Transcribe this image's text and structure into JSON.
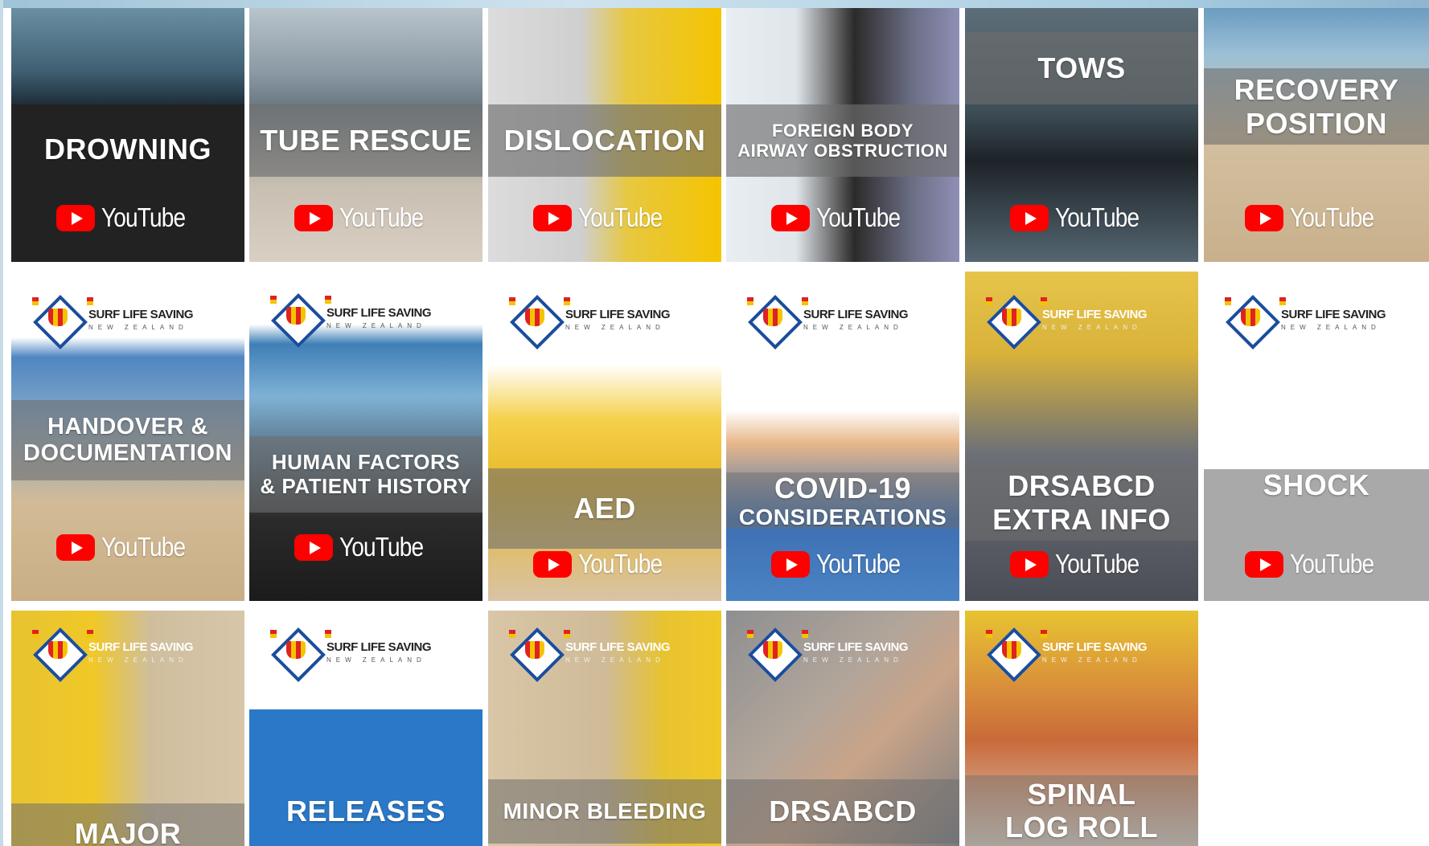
{
  "colors": {
    "youtube_red": "#ff0000",
    "band_grey": "#8c8c8c",
    "surf_yellow": "#f5c400",
    "surf_red": "#e02222",
    "logo_blue": "#1b4d9c"
  },
  "youtube": {
    "label": "YouTube",
    "icon": "youtube-play-icon"
  },
  "logo": {
    "main": "SURF LIFE SAVING",
    "sub": "NEW ZEALAND"
  },
  "tiles": [
    {
      "id": "drowning",
      "title": "DROWNING",
      "youtube": true
    },
    {
      "id": "tube-rescue",
      "title": "TUBE RESCUE",
      "youtube": true
    },
    {
      "id": "dislocation",
      "title": "DISLOCATION",
      "youtube": true
    },
    {
      "id": "fbao",
      "title_line1": "FOREIGN BODY",
      "title_line2": "AIRWAY OBSTRUCTION",
      "youtube": true
    },
    {
      "id": "tows",
      "title": "TOWS",
      "youtube": true
    },
    {
      "id": "recovery-position",
      "title_line1": "RECOVERY",
      "title_line2": "POSITION",
      "youtube": true
    },
    {
      "id": "handover",
      "title_line1": "HANDOVER &",
      "title_line2": "DOCUMENTATION",
      "youtube": true
    },
    {
      "id": "human-factors",
      "title_line1": "HUMAN FACTORS",
      "title_line2": "& PATIENT HISTORY",
      "youtube": true
    },
    {
      "id": "aed",
      "title": "AED",
      "youtube": true
    },
    {
      "id": "covid",
      "title_line1": "COVID-19",
      "title_line2": "CONSIDERATIONS",
      "youtube": true
    },
    {
      "id": "drsabcd-extra",
      "title_line1": "DRSABCD",
      "title_line2": "EXTRA INFO",
      "youtube": true
    },
    {
      "id": "shock",
      "title": "SHOCK",
      "youtube": true
    },
    {
      "id": "major",
      "title": "MAJOR",
      "youtube": false
    },
    {
      "id": "releases",
      "title": "RELEASES",
      "youtube": false
    },
    {
      "id": "minor-bleeding",
      "title": "MINOR BLEEDING",
      "youtube": false
    },
    {
      "id": "drsabcd",
      "title": "DRSABCD",
      "youtube": false
    },
    {
      "id": "spinal-log-roll",
      "title_line1": "SPINAL",
      "title_line2": "LOG ROLL",
      "youtube": false
    }
  ]
}
